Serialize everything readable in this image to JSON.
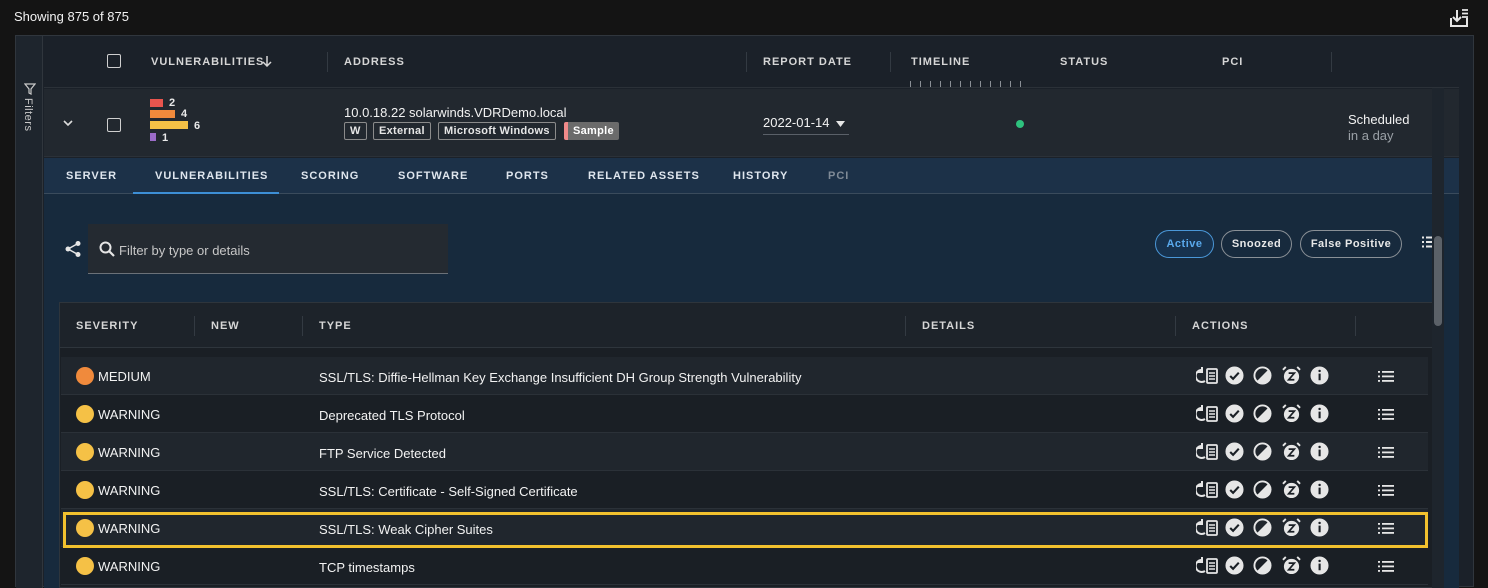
{
  "topbar": {
    "count_text": "Showing 875 of 875"
  },
  "filters": {
    "label": "Filters"
  },
  "header": {
    "vulnerabilities": "VULNERABILITIES",
    "address": "ADDRESS",
    "report_date": "REPORT DATE",
    "timeline": "TIMELINE",
    "status": "STATUS",
    "pci": "PCI"
  },
  "asset": {
    "severity_counts": [
      {
        "count": "2",
        "color": "#e8554e",
        "share": 0.33
      },
      {
        "count": "4",
        "color": "#f08a3c",
        "share": 0.67
      },
      {
        "count": "6",
        "color": "#f5c146",
        "share": 1.0
      },
      {
        "count": "1",
        "color": "#9b6cc9",
        "share": 0.17
      }
    ],
    "address": "10.0.18.22 solarwinds.VDRDemo.local",
    "tags": [
      "W",
      "External",
      "Microsoft Windows",
      "Sample"
    ],
    "report_date": "2022-01-14",
    "status_line1": "Scheduled",
    "status_line2": "in a day",
    "status_color": "#2ec27e"
  },
  "tabs": [
    "SERVER",
    "VULNERABILITIES",
    "SCORING",
    "SOFTWARE",
    "PORTS",
    "RELATED ASSETS",
    "HISTORY",
    "PCI"
  ],
  "panel": {
    "search_placeholder": "Filter by type or details",
    "chips": {
      "active": "Active",
      "snoozed": "Snoozed",
      "false_positive": "False Positive"
    }
  },
  "table": {
    "headers": {
      "severity": "SEVERITY",
      "new": "NEW",
      "type": "TYPE",
      "details": "DETAILS",
      "actions": "ACTIONS"
    },
    "rows": [
      {
        "severity": "MEDIUM",
        "color": "#f08a3c",
        "type": "SSL/TLS: Diffie-Hellman Key Exchange Insufficient DH Group Strength Vulnerability"
      },
      {
        "severity": "WARNING",
        "color": "#f5c146",
        "type": "Deprecated TLS Protocol"
      },
      {
        "severity": "WARNING",
        "color": "#f5c146",
        "type": "FTP Service Detected"
      },
      {
        "severity": "WARNING",
        "color": "#f5c146",
        "type": "SSL/TLS: Certificate - Self-Signed Certificate"
      },
      {
        "severity": "WARNING",
        "color": "#f5c146",
        "type": "SSL/TLS: Weak Cipher Suites"
      },
      {
        "severity": "WARNING",
        "color": "#f5c146",
        "type": "TCP timestamps"
      }
    ]
  }
}
